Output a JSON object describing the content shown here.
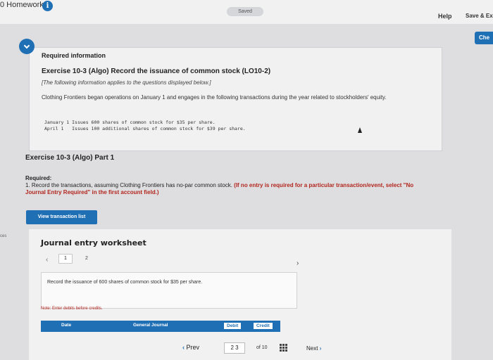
{
  "header": {
    "title": "0 Homework",
    "saved": "Saved",
    "help": "Help",
    "save_exit": "Save & Ex",
    "check": "Che"
  },
  "required_info": {
    "title": "Required information",
    "heading": "Exercise 10-3 (Algo) Record the issuance of common stock (LO10-2)",
    "note": "[The following information applies to the questions displayed below.]",
    "description": "Clothing Frontiers began operations on January 1 and engages in the following transactions during the year related to stockholders' equity.",
    "transactions": [
      "January 1 Issues 600 shares of common stock for $35 per share.",
      "April 1   Issues 100 additional shares of common stock for $39 per share."
    ]
  },
  "part": {
    "title": "Exercise 10-3 (Algo) Part 1",
    "required_label": "Required:",
    "required_text": "1. Record the transactions, assuming Clothing Frontiers has no-par common stock.",
    "required_red": "(If no entry is required for a particular transaction/event, select \"No Journal Entry Required\" in the first account field.)",
    "view_button": "View transaction list"
  },
  "side_text": "ces",
  "worksheet": {
    "title": "Journal entry worksheet",
    "pages": [
      "1",
      "2"
    ],
    "record_text": "Record the issuance of 600 shares of common stock for $35 per share.",
    "note": "Note: Enter debits before credits.",
    "columns": [
      "Date",
      "General Journal",
      "Debit",
      "Credit"
    ]
  },
  "navigation": {
    "prev": "Prev",
    "current": "2  3",
    "of": "of 10",
    "next": "Next"
  }
}
